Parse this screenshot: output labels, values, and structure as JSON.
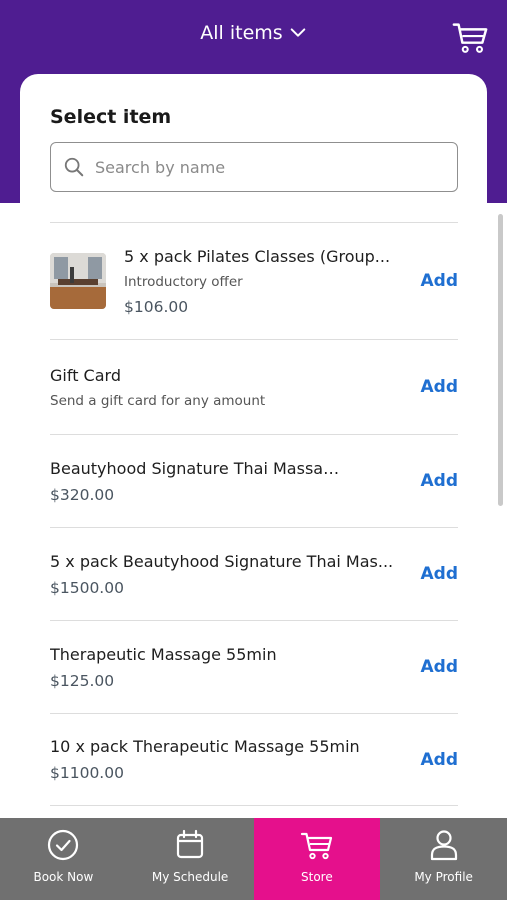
{
  "header": {
    "title": "All items",
    "icons": [
      "chevron-down-icon",
      "cart-icon"
    ]
  },
  "card": {
    "title": "Select item",
    "search": {
      "placeholder": "Search by name",
      "value": ""
    }
  },
  "items": [
    {
      "name": "5 x pack Pilates Classes (Group...",
      "subtitle": "Introductory offer",
      "price": "$106.00",
      "has_thumb": true,
      "action": "Add"
    },
    {
      "name": "Gift Card",
      "subtitle": "Send a gift card for any amount",
      "action": "Add"
    },
    {
      "name": "Beautyhood Signature Thai Massage",
      "price": "$320.00",
      "action": "Add"
    },
    {
      "name": "5 x pack Beautyhood Signature Thai Mas...",
      "price": "$1500.00",
      "action": "Add"
    },
    {
      "name": "Therapeutic Massage 55min",
      "price": "$125.00",
      "action": "Add"
    },
    {
      "name": "10 x pack Therapeutic Massage 55min",
      "price": "$1100.00",
      "action": "Add"
    }
  ],
  "tabbar": {
    "tabs": [
      {
        "label": "Book Now",
        "icon": "check-circle-icon"
      },
      {
        "label": "My Schedule",
        "icon": "calendar-icon"
      },
      {
        "label": "Store",
        "icon": "cart-icon",
        "active": true
      },
      {
        "label": "My Profile",
        "icon": "person-icon"
      }
    ]
  },
  "colors": {
    "header_purple": "#4f1d91",
    "accent_pink": "#e5108c",
    "link_blue": "#1f6fd1",
    "tabbar_gray": "#707070"
  }
}
